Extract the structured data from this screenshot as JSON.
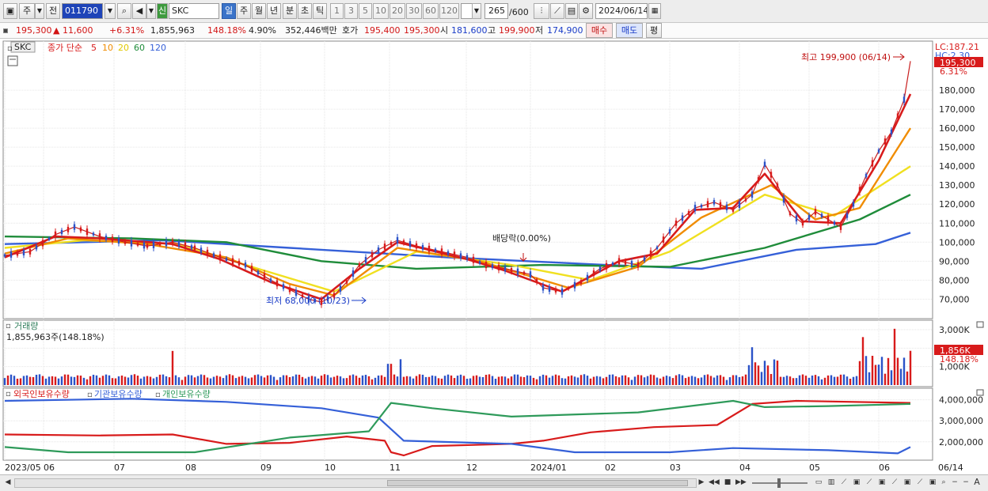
{
  "toolbar": {
    "market_btn": "주",
    "prev_btn": "전",
    "code": "011790",
    "name_badge": "신",
    "name": "SKC",
    "periods": [
      "일",
      "주",
      "월",
      "년",
      "분",
      "초",
      "틱"
    ],
    "counts": [
      "1",
      "3",
      "5",
      "10",
      "20",
      "30",
      "60",
      "120"
    ],
    "bar_count": "265",
    "bar_total": "/600",
    "date": "2024/06/14"
  },
  "quote": {
    "price": "195,300",
    "change": "▲   11,600",
    "change_pct": "+6.31%",
    "volume": "1,855,963",
    "vol_ratio": "148.18%",
    "turnover": "4.90%",
    "amount": "352,446백만",
    "ask_label": "호가",
    "ask": "195,400",
    "bid": "195,300",
    "open_label": "시",
    "open": "181,600",
    "high_label": "고",
    "high": "199,900",
    "low_label": "저",
    "low": "174,900",
    "buy": "매수",
    "sell": "매도",
    "avg": "평"
  },
  "price_panel": {
    "symbol": "SKC",
    "ma_label": "종가 단순",
    "ma": [
      {
        "period": "5",
        "color": "#d81b1b"
      },
      {
        "period": "10",
        "color": "#f08c00"
      },
      {
        "period": "20",
        "color": "#e8d800"
      },
      {
        "period": "60",
        "color": "#1f8c3a"
      },
      {
        "period": "120",
        "color": "#3560d8"
      }
    ],
    "lc": "LC:187.21",
    "hc": "HC:2.30",
    "cur_price": "195,300",
    "cur_pct": "6.31%",
    "high_note": "최고 199,900 (06/14)",
    "low_note": "최저 68,000 (10/23)",
    "div_note": "배당락(0.00%)",
    "yaxis": [
      "180,000",
      "170,000",
      "160,000",
      "150,000",
      "140,000",
      "130,000",
      "120,000",
      "110,000",
      "100,000",
      "90,000",
      "80,000",
      "70,000"
    ]
  },
  "volume_panel": {
    "title": "거래량",
    "value": "1,855,963주(148.18%)",
    "yaxis": [
      "3,000K",
      "2,000K",
      "1,000K"
    ],
    "cur": "1,856K",
    "cur_pct": "148.18%"
  },
  "holding_panel": {
    "series": [
      {
        "name": "외국인보유수량",
        "color": "#d81b1b"
      },
      {
        "name": "기관보유수량",
        "color": "#3560d8"
      },
      {
        "name": "개인보유수량",
        "color": "#2e9a5a"
      }
    ],
    "yaxis": [
      "4,000,000",
      "3,000,000",
      "2,000,000"
    ]
  },
  "xaxis": [
    "2023/05",
    "06",
    "07",
    "08",
    "09",
    "10",
    "11",
    "12",
    "2024/01",
    "02",
    "03",
    "04",
    "05",
    "06"
  ],
  "x_last": "06/14",
  "chart_data": {
    "type": "line",
    "title": "SKC",
    "ylim": [
      61000,
      205000
    ],
    "months": [
      "2023/05",
      "06",
      "07",
      "08",
      "09",
      "10",
      "11",
      "12",
      "2024/01",
      "02",
      "03",
      "04",
      "05",
      "06"
    ],
    "close_path": [
      [
        0,
        93000
      ],
      [
        8,
        95000
      ],
      [
        16,
        104000
      ],
      [
        22,
        108000
      ],
      [
        30,
        103000
      ],
      [
        38,
        100000
      ],
      [
        45,
        98000
      ],
      [
        53,
        100000
      ],
      [
        60,
        97000
      ],
      [
        68,
        92000
      ],
      [
        76,
        88000
      ],
      [
        84,
        80000
      ],
      [
        90,
        75000
      ],
      [
        96,
        70000
      ],
      [
        100,
        68500
      ],
      [
        104,
        72000
      ],
      [
        108,
        79000
      ],
      [
        112,
        88000
      ],
      [
        118,
        96000
      ],
      [
        124,
        101000
      ],
      [
        130,
        98000
      ],
      [
        138,
        95000
      ],
      [
        146,
        92000
      ],
      [
        152,
        88000
      ],
      [
        158,
        86000
      ],
      [
        166,
        83000
      ],
      [
        170,
        76000
      ],
      [
        176,
        74000
      ],
      [
        182,
        79000
      ],
      [
        188,
        86000
      ],
      [
        194,
        90000
      ],
      [
        200,
        88000
      ],
      [
        206,
        97000
      ],
      [
        212,
        110000
      ],
      [
        218,
        118000
      ],
      [
        224,
        121000
      ],
      [
        230,
        117000
      ],
      [
        236,
        125000
      ],
      [
        240,
        141000
      ],
      [
        244,
        130000
      ],
      [
        248,
        115000
      ],
      [
        252,
        110000
      ],
      [
        256,
        116000
      ],
      [
        260,
        112000
      ],
      [
        264,
        108000
      ],
      [
        268,
        120000
      ],
      [
        272,
        135000
      ],
      [
        276,
        148000
      ],
      [
        280,
        158000
      ],
      [
        284,
        175000
      ],
      [
        286,
        195300
      ]
    ],
    "ma5_path": [
      [
        0,
        92000
      ],
      [
        16,
        103000
      ],
      [
        30,
        102000
      ],
      [
        53,
        99000
      ],
      [
        68,
        91000
      ],
      [
        84,
        79000
      ],
      [
        100,
        70000
      ],
      [
        112,
        86000
      ],
      [
        124,
        100000
      ],
      [
        146,
        91000
      ],
      [
        158,
        85000
      ],
      [
        176,
        74000
      ],
      [
        194,
        90000
      ],
      [
        206,
        94000
      ],
      [
        218,
        117000
      ],
      [
        230,
        118000
      ],
      [
        240,
        136000
      ],
      [
        252,
        111000
      ],
      [
        264,
        110000
      ],
      [
        276,
        143000
      ],
      [
        286,
        178000
      ]
    ],
    "ma10_path": [
      [
        0,
        94000
      ],
      [
        20,
        102000
      ],
      [
        45,
        99000
      ],
      [
        70,
        92000
      ],
      [
        90,
        78000
      ],
      [
        104,
        72000
      ],
      [
        124,
        97000
      ],
      [
        150,
        90000
      ],
      [
        178,
        76000
      ],
      [
        200,
        87000
      ],
      [
        220,
        113000
      ],
      [
        242,
        130000
      ],
      [
        256,
        112000
      ],
      [
        270,
        118000
      ],
      [
        286,
        160000
      ]
    ],
    "ma20_path": [
      [
        0,
        97000
      ],
      [
        25,
        101000
      ],
      [
        55,
        99000
      ],
      [
        80,
        86000
      ],
      [
        104,
        74000
      ],
      [
        130,
        95000
      ],
      [
        160,
        88000
      ],
      [
        185,
        80000
      ],
      [
        210,
        95000
      ],
      [
        240,
        125000
      ],
      [
        262,
        114000
      ],
      [
        286,
        140000
      ]
    ],
    "ma60_path": [
      [
        0,
        103000
      ],
      [
        40,
        102000
      ],
      [
        70,
        100000
      ],
      [
        100,
        90000
      ],
      [
        130,
        86000
      ],
      [
        170,
        88000
      ],
      [
        210,
        87000
      ],
      [
        240,
        97000
      ],
      [
        270,
        112000
      ],
      [
        286,
        125000
      ]
    ],
    "ma120_path": [
      [
        0,
        99000
      ],
      [
        50,
        101000
      ],
      [
        90,
        97000
      ],
      [
        140,
        92000
      ],
      [
        190,
        88000
      ],
      [
        220,
        86000
      ],
      [
        250,
        96000
      ],
      [
        275,
        99000
      ],
      [
        286,
        105000
      ]
    ]
  }
}
